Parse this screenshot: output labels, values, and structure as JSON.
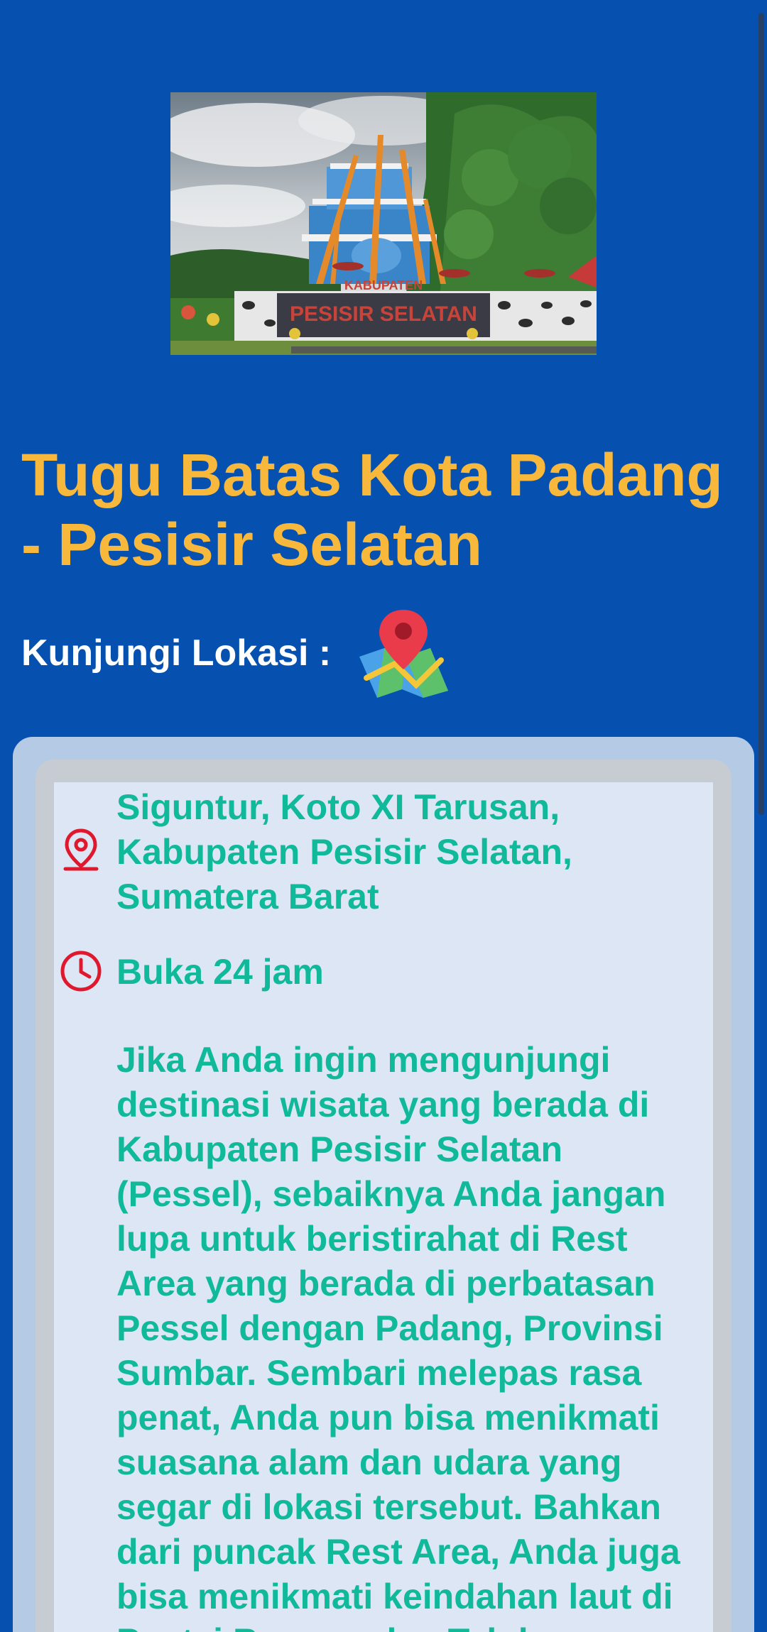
{
  "title": "Tugu Batas Kota Padang - Pesisir Selatan",
  "visit": {
    "label": "Kunjungi Lokasi :",
    "icon": "map-pin-icon"
  },
  "hero": {
    "sign_line1": "KABUPATEN",
    "sign_line2": "PESISIR SELATAN"
  },
  "info": {
    "address": "Siguntur, Koto XI Tarusan, Kabupaten Pesisir Selatan, Sumatera Barat",
    "hours": "Buka 24 jam",
    "description": "Jika Anda ingin mengunjungi destinasi wisata yang berada di Kabupaten Pesisir Selatan (Pessel), sebaiknya Anda jangan lupa untuk beristirahat di Rest Area yang berada di perbatasan Pessel dengan Padang, Provinsi Sumbar. Sembari melepas rasa penat, Anda pun bisa menikmati suasana alam dan udara yang segar di lokasi tersebut. Bahkan dari puncak Rest Area, Anda juga bisa menikmati keindahan laut di Pantai Bungus dan Teluk"
  },
  "colors": {
    "background": "#0650b0",
    "title": "#f8b83b",
    "info_text": "#11b99b",
    "icon_red": "#e0182d"
  }
}
